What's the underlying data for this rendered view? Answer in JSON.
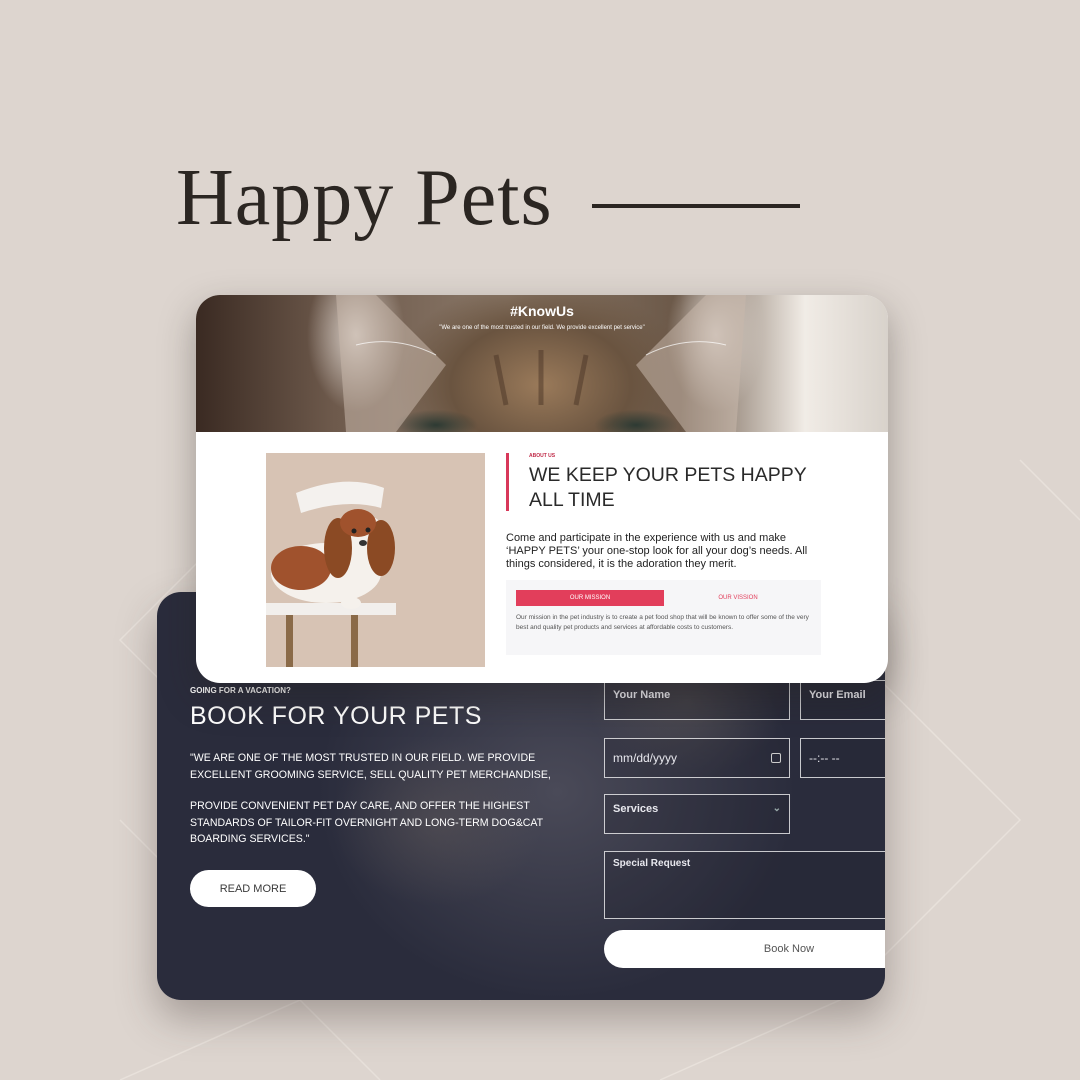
{
  "brand": {
    "title": "Happy Pets"
  },
  "know_us": {
    "title": "#KnowUs",
    "subtitle": "\"We are one of the most trusted in our field. We provide excellent pet service\"",
    "about_label": "ABOUT US",
    "heading": "WE KEEP YOUR PETS HAPPY ALL TIME",
    "description": "Come and participate in the experience with us and make ‘HAPPY PETS’ your one-stop look for all your dog’s needs. All things considered, it is the adoration they merit.",
    "tabs": [
      {
        "label": "OUR MISSION",
        "active": true
      },
      {
        "label": "OUR VISSION",
        "active": false
      }
    ],
    "mission_text": "Our mission in the pet industry is to create a pet food shop that will be known to offer some of the very best and quality pet products and services at affordable costs to customers."
  },
  "booking": {
    "eyebrow": "GOING FOR A VACATION?",
    "heading": "BOOK FOR YOUR PETS",
    "paragraph_1": "\"We are one of the most trusted in our field. We provide excellent grooming service, sell quality pet merchandise,",
    "paragraph_2": "provide convenient pet day care, and offer the highest standards of tailor-fit overnight and long-term dog&cat boarding services.\"",
    "read_more_label": "READ MORE",
    "form": {
      "name_placeholder": "Your Name",
      "email_placeholder": "Your Email",
      "date_placeholder": "mm/dd/yyyy",
      "time_placeholder": "--:-- --",
      "services_label": "Services",
      "request_placeholder": "Special Request",
      "submit_label": "Book Now"
    }
  },
  "colors": {
    "background": "#ddd5cf",
    "accent": "#e23e5b",
    "dark_card": "#2a2c3c"
  }
}
